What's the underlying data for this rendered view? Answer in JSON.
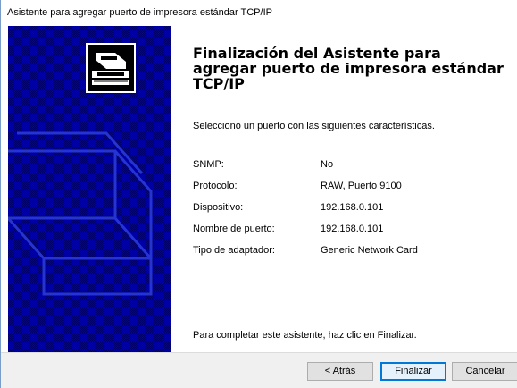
{
  "window": {
    "title": "Asistente para agregar puerto de impresora estándar TCP/IP"
  },
  "sidebar": {
    "image": "printer-wizard-graphic"
  },
  "content": {
    "heading": "Finalización del Asistente para agregar puerto de impresora estándar TCP/IP",
    "intro": "Seleccionó un puerto con las siguientes características.",
    "properties": [
      {
        "label": "SNMP:",
        "value": "No"
      },
      {
        "label": "Protocolo:",
        "value": "RAW, Puerto 9100"
      },
      {
        "label": "Dispositivo:",
        "value": "192.168.0.101"
      },
      {
        "label": "Nombre de puerto:",
        "value": "192.168.0.101"
      },
      {
        "label": "Tipo de adaptador:",
        "value": "Generic Network Card"
      }
    ],
    "finish_text": "Para completar este asistente, haz clic en Finalizar."
  },
  "buttons": {
    "back_prefix": "< ",
    "back_accel": "A",
    "back_rest": "trás",
    "finish": "Finalizar",
    "cancel": "Cancelar"
  },
  "colors": {
    "sidebar": "#0000a8",
    "accent": "#0078d7"
  }
}
